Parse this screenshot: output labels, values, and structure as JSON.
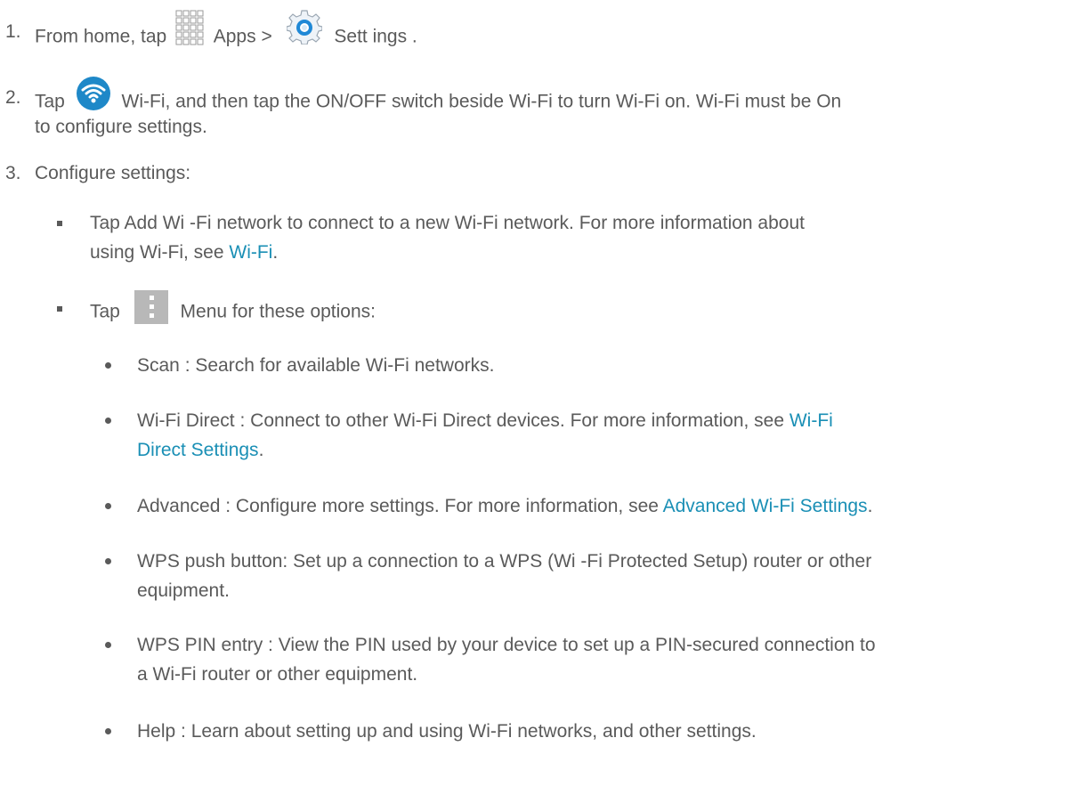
{
  "steps": [
    {
      "number": "1.",
      "text_before": "From home, tap ",
      "apps_label": " Apps  > ",
      "settings_label": " Sett ings ."
    },
    {
      "number": "2.",
      "text_before": "Tap ",
      "line1": " Wi-Fi, and then tap the ON/OFF switch beside Wi-Fi to turn Wi-Fi on. Wi-Fi must be On",
      "line2": "to configure settings."
    },
    {
      "number": "3.",
      "text": "Configure settings:"
    }
  ],
  "sub_items": {
    "add_network": {
      "line1": "Tap Add Wi -Fi network  to connect to a new Wi-Fi network. For more information about",
      "line2_prefix": "using Wi-Fi, see ",
      "line2_link": "Wi-Fi",
      "line2_suffix": "."
    },
    "menu": {
      "text_before": "Tap ",
      "text_after": " Menu for these options:"
    }
  },
  "menu_options": [
    {
      "text": "Scan : Search for available Wi-Fi networks."
    },
    {
      "line1_prefix": "Wi-Fi Direct : Connect to other Wi-Fi Direct devices. For more information, see ",
      "line1_link": "Wi-Fi",
      "line2_link": "Direct Settings",
      "line2_suffix": "."
    },
    {
      "line1_prefix": "Advanced : Configure more settings. For more information, see ",
      "line1_link": "Advanced Wi-Fi Settings",
      "line1_suffix": "."
    },
    {
      "line1": "WPS push button: Set up a connection to a WPS (Wi  -Fi Protected Setup) router or other",
      "line2": "equipment."
    },
    {
      "line1": "WPS PIN entry : View the PIN used by your device to set up a PIN-secured connection to",
      "line2": "a Wi-Fi router or other equipment."
    },
    {
      "text": "Help : Learn about setting up and using Wi-Fi networks, and other settings."
    }
  ],
  "icons": {
    "apps": "apps-grid-icon",
    "settings": "settings-gear-icon",
    "wifi": "wifi-icon",
    "menu": "menu-kebab-icon"
  },
  "colors": {
    "text": "#5a5a5a",
    "link": "#1a8fb5",
    "wifi_circle": "#1e88c8",
    "settings_blue": "#1f88d6"
  }
}
